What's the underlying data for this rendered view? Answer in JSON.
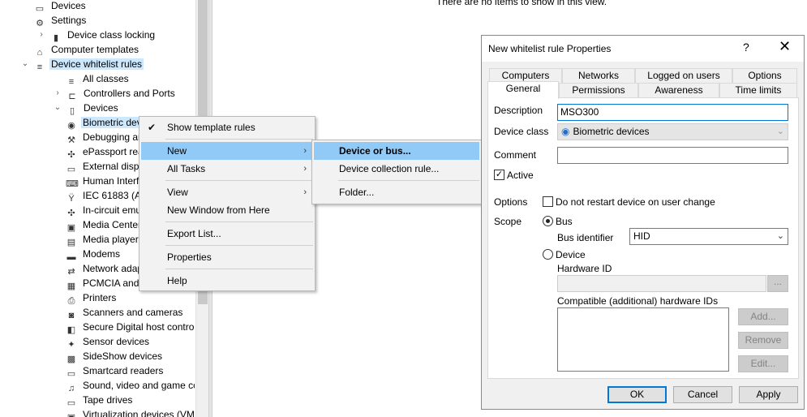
{
  "tree": {
    "items": [
      {
        "label": "Devices",
        "icon": "devices-icon",
        "expander": "",
        "selected": false
      },
      {
        "label": "Settings",
        "icon": "gear-icon",
        "expander": "",
        "selected": false
      },
      {
        "label": "Device class locking",
        "icon": "lock-icon",
        "expander": "›",
        "selected": false
      },
      {
        "label": "Computer templates",
        "icon": "computer-template-icon",
        "expander": "",
        "selected": false
      },
      {
        "label": "Device whitelist rules",
        "icon": "list-icon",
        "expander": "⌄",
        "selected": true
      },
      {
        "label": "All classes",
        "icon": "list-icon",
        "expander": "",
        "selected": false
      },
      {
        "label": "Controllers and Ports",
        "icon": "port-icon",
        "expander": "›",
        "selected": false
      },
      {
        "label": "Devices",
        "icon": "device-icon",
        "expander": "⌄",
        "selected": false
      },
      {
        "label": "Biometric devi",
        "icon": "fingerprint-icon",
        "expander": "",
        "selected": true
      },
      {
        "label": "Debugging ar",
        "icon": "debug-icon",
        "expander": "",
        "selected": false
      },
      {
        "label": "ePassport rea",
        "icon": "generic-device-icon",
        "expander": "",
        "selected": false
      },
      {
        "label": "External displ",
        "icon": "monitor-icon",
        "expander": "",
        "selected": false
      },
      {
        "label": "Human Interf",
        "icon": "keyboard-icon",
        "expander": "",
        "selected": false
      },
      {
        "label": "IEC 61883 (AV",
        "icon": "firewire-icon",
        "expander": "",
        "selected": false
      },
      {
        "label": "In-circuit emu",
        "icon": "generic-device-icon",
        "expander": "",
        "selected": false
      },
      {
        "label": "Media Center",
        "icon": "media-icon",
        "expander": "",
        "selected": false
      },
      {
        "label": "Media player",
        "icon": "media-player-icon",
        "expander": "",
        "selected": false
      },
      {
        "label": "Modems",
        "icon": "modem-icon",
        "expander": "",
        "selected": false
      },
      {
        "label": "Network adap",
        "icon": "network-icon",
        "expander": "",
        "selected": false
      },
      {
        "label": "PCMCIA and",
        "icon": "pcmcia-icon",
        "expander": "",
        "selected": false
      },
      {
        "label": "Printers",
        "icon": "printer-icon",
        "expander": "",
        "selected": false
      },
      {
        "label": "Scanners and cameras",
        "icon": "camera-icon",
        "expander": "",
        "selected": false
      },
      {
        "label": "Secure Digital host control",
        "icon": "sd-card-icon",
        "expander": "",
        "selected": false
      },
      {
        "label": "Sensor devices",
        "icon": "sensor-icon",
        "expander": "",
        "selected": false
      },
      {
        "label": "SideShow devices",
        "icon": "sideshow-icon",
        "expander": "",
        "selected": false
      },
      {
        "label": "Smartcard readers",
        "icon": "smartcard-icon",
        "expander": "",
        "selected": false
      },
      {
        "label": "Sound, video and game cc",
        "icon": "speaker-icon",
        "expander": "",
        "selected": false
      },
      {
        "label": "Tape drives",
        "icon": "tape-icon",
        "expander": "",
        "selected": false
      },
      {
        "label": "Virtualization devices (VM",
        "icon": "virtualization-icon",
        "expander": "",
        "selected": false
      }
    ]
  },
  "list_pane": {
    "empty_message": "There are no items to show in this view."
  },
  "context_menu": {
    "items": [
      {
        "label": "Show template rules",
        "checked": true,
        "submenu": false,
        "highlighted": false
      },
      {
        "label": "New",
        "checked": false,
        "submenu": true,
        "highlighted": true
      },
      {
        "label": "All Tasks",
        "checked": false,
        "submenu": true,
        "highlighted": false
      },
      {
        "label": "View",
        "checked": false,
        "submenu": true,
        "highlighted": false
      },
      {
        "label": "New Window from Here",
        "checked": false,
        "submenu": false,
        "highlighted": false
      },
      {
        "label": "Export List...",
        "checked": false,
        "submenu": false,
        "highlighted": false
      },
      {
        "label": "Properties",
        "checked": false,
        "submenu": false,
        "highlighted": false
      },
      {
        "label": "Help",
        "checked": false,
        "submenu": false,
        "highlighted": false
      }
    ]
  },
  "submenu": {
    "items": [
      {
        "label": "Device or bus...",
        "highlighted": true
      },
      {
        "label": "Device collection rule...",
        "highlighted": false
      },
      {
        "label": "Folder...",
        "highlighted": false
      }
    ]
  },
  "dialog": {
    "title": "New whitelist rule Properties",
    "help_glyph": "?",
    "close_glyph": "✕",
    "tabs_back": [
      "Computers",
      "Networks",
      "Logged on users",
      "Options"
    ],
    "tabs_front": [
      "General",
      "Permissions",
      "Awareness",
      "Time limits"
    ],
    "active_tab": "General",
    "description_label": "Description",
    "description_value": "MSO300",
    "device_class_label": "Device class",
    "device_class_value": "Biometric devices",
    "comment_label": "Comment",
    "comment_value": "",
    "active_label": "Active",
    "active_checked": true,
    "options_label": "Options",
    "no_restart_label": "Do not restart device on user change",
    "no_restart_checked": false,
    "scope_label": "Scope",
    "bus_label": "Bus",
    "bus_selected": true,
    "bus_identifier_label": "Bus identifier",
    "bus_identifier_value": "HID",
    "device_label": "Device",
    "hardware_id_label": "Hardware ID",
    "hardware_id_value": "",
    "browse_label": "...",
    "compatible_ids_label": "Compatible (additional) hardware IDs",
    "add_label": "Add...",
    "remove_label": "Remove",
    "edit_label": "Edit...",
    "ok_label": "OK",
    "cancel_label": "Cancel",
    "apply_label": "Apply"
  }
}
